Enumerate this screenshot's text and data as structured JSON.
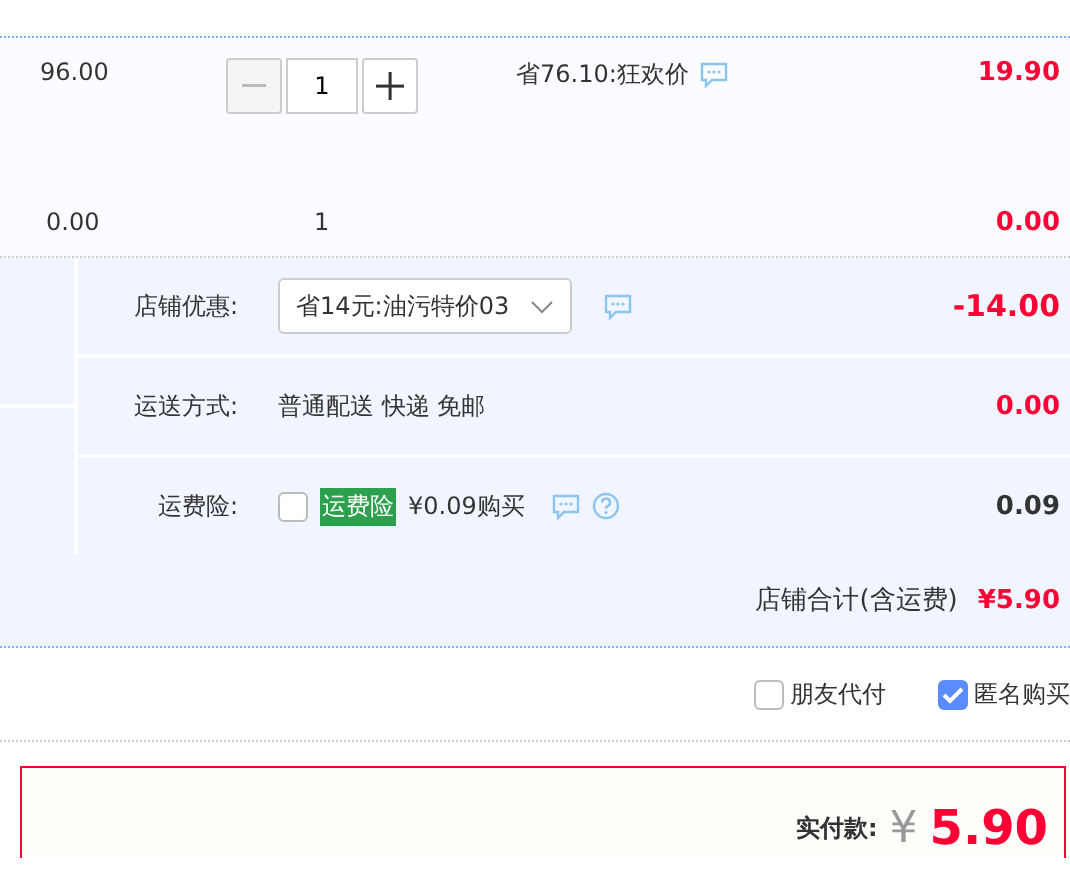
{
  "items": [
    {
      "price": "96.00",
      "quantity": "1",
      "stepper": true,
      "promo": "省76.10:狂欢价",
      "subtotal": "19.90"
    },
    {
      "price": "0.00",
      "quantity": "1",
      "stepper": false,
      "subtotal": "0.00"
    }
  ],
  "shop_rows": [
    {
      "kind": "select",
      "label": "店铺优惠:",
      "value": "省14元:油污特价03",
      "amount": "-14.00",
      "highlight": true
    },
    {
      "kind": "text",
      "label": "运送方式:",
      "value": "普通配送 快递 免邮",
      "amount": "0.00",
      "highlight": true
    },
    {
      "kind": "insurance",
      "label": "运费险:",
      "checked": false,
      "tag": "运费险",
      "value": "¥0.09购买",
      "amount": "0.09",
      "highlight": false
    }
  ],
  "shop_total": {
    "label": "店铺合计(含运费)",
    "amount": "¥5.90"
  },
  "options": [
    {
      "label": "朋友代付",
      "checked": false
    },
    {
      "label": "匿名购买",
      "checked": true
    }
  ],
  "payment": {
    "label": "实付款:",
    "currency": "¥",
    "amount": "5.90"
  }
}
